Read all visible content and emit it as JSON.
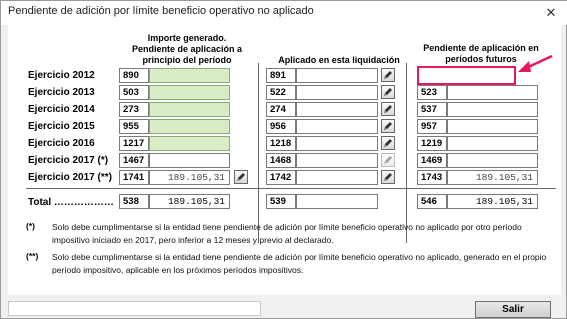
{
  "window": {
    "title": "Pendiente de adición por límite beneficio operativo no aplicado",
    "close_glyph": "✕"
  },
  "headers": {
    "col1_line1": "Importe generado.",
    "col1_line2": "Pendiente de aplicación a",
    "col1_line3": "principio del período",
    "col2": "Aplicado en esta liquidación",
    "col3_line1": "Pendiente de aplicación en",
    "col3_line2": "períodos futuros"
  },
  "rows": [
    {
      "label": "Ejercicio 2012",
      "code1": "890",
      "val1": "",
      "code2": "891",
      "val2": "",
      "code3": "",
      "val3": ""
    },
    {
      "label": "Ejercicio 2013",
      "code1": "503",
      "val1": "",
      "code2": "522",
      "val2": "",
      "code3": "523",
      "val3": ""
    },
    {
      "label": "Ejercicio 2014",
      "code1": "273",
      "val1": "",
      "code2": "274",
      "val2": "",
      "code3": "537",
      "val3": ""
    },
    {
      "label": "Ejercicio 2015",
      "code1": "955",
      "val1": "",
      "code2": "956",
      "val2": "",
      "code3": "957",
      "val3": ""
    },
    {
      "label": "Ejercicio 2016",
      "code1": "1217",
      "val1": "",
      "code2": "1218",
      "val2": "",
      "code3": "1219",
      "val3": ""
    },
    {
      "label": "Ejercicio 2017 (*)",
      "code1": "1467",
      "val1": "",
      "code2": "1468",
      "val2": "",
      "code3": "1469",
      "val3": ""
    },
    {
      "label": "Ejercicio 2017 (**)",
      "code1": "1741",
      "val1": "189.105,31",
      "code2": "1742",
      "val2": "",
      "code3": "1743",
      "val3": "189.105,31"
    }
  ],
  "total": {
    "label": "Total ………………",
    "code1": "538",
    "val1": "189.105,31",
    "code2": "539",
    "val2": "",
    "code3": "546",
    "val3": "189.105,31"
  },
  "notes": [
    {
      "mark": "(*)",
      "text": "Solo debe cumplimentarse si la entidad tiene pendiente de adición por límite beneficio operativo no aplicado por otro período impositivo iniciado en 2017, pero inferior a 12 meses y previo al declarado."
    },
    {
      "mark": "(**)",
      "text": "Solo debe cumplimentarse si la entidad tiene pendiente de adición por límite beneficio operativo no aplicado, generado en el propio período impositivo, aplicable en los próximos períodos impositivos."
    }
  ],
  "footer": {
    "exit_label": "Salir"
  },
  "colors": {
    "green_field": "#d9ecc6",
    "highlight": "#e8185e",
    "arrow": "#e8185e"
  }
}
